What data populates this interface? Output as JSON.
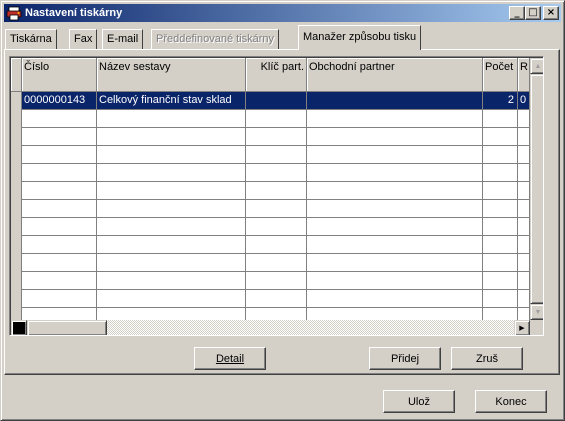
{
  "window": {
    "title": "Nastavení tiskárny",
    "controls": {
      "minimize": "_",
      "maximize": "□",
      "close": "×"
    }
  },
  "tabs": [
    {
      "label": "Tiskárna",
      "active": false,
      "disabled": false
    },
    {
      "label": "Fax",
      "active": false,
      "disabled": false
    },
    {
      "label": "E-mail",
      "active": false,
      "disabled": false
    },
    {
      "label": "Předdefinované tiskárny",
      "active": false,
      "disabled": true
    },
    {
      "label": "Manažer způsobu tisku",
      "active": true,
      "disabled": false
    }
  ],
  "table": {
    "columns": [
      "Číslo",
      "Název sestavy",
      "Klíč part.",
      "Obchodní partner",
      "Počet",
      "R"
    ],
    "rows": [
      [
        "0000000143",
        "Celkový finanční stav sklad",
        "",
        "",
        "2",
        "0"
      ]
    ],
    "selected_row": 0
  },
  "scrollbars": {
    "up_arrow": "▲",
    "down_arrow": "▼",
    "left_arrow": "◀",
    "right_arrow": "▶"
  },
  "panel_buttons": {
    "detail": "Detail",
    "add": "Přidej",
    "cancel": "Zruš"
  },
  "footer_buttons": {
    "save": "Ulož",
    "close": "Konec"
  },
  "colors": {
    "face": "#d4d0c8",
    "title_start": "#0a246a",
    "title_end": "#a6caf0",
    "selection": "#0a246a"
  },
  "icons": [
    "printer-icon"
  ]
}
